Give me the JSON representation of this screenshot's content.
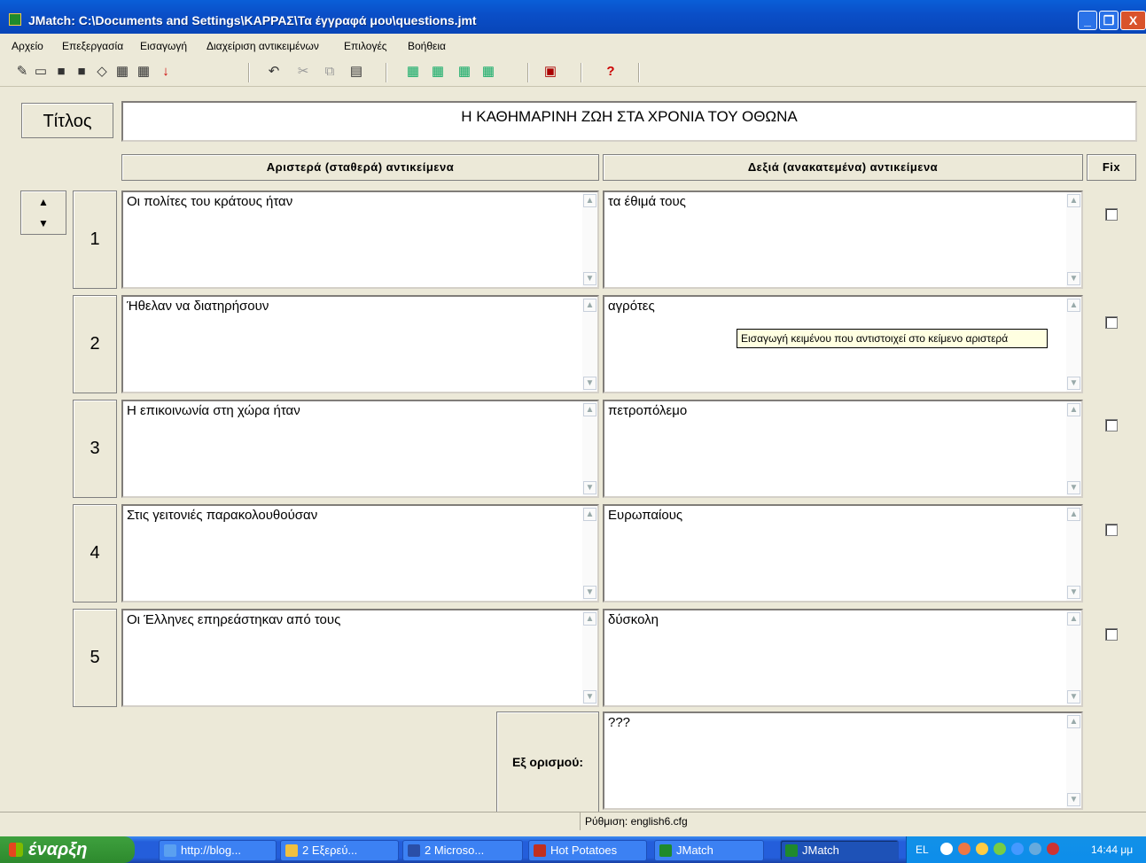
{
  "window": {
    "title": "JMatch: C:\\Documents and Settings\\ΚΑΡΡΑΣ\\Τα έγγραφά μου\\questions.jmt",
    "minimize": "_",
    "maximize": "❐",
    "close": "X"
  },
  "menu": [
    "Αρχείο",
    "Επεξεργασία",
    "Εισαγωγή",
    "Διαχείριση αντικειμένων",
    "Επιλογές",
    "Βοήθεια"
  ],
  "title_label": "Τίτλος",
  "title_value": "Η ΚΑΘΗΜΑΡΙΝΗ ΖΩΗ ΣΤΑ ΧΡΟΝΙΑ ΤΟΥ ΟΘΩΝΑ",
  "headers": {
    "left": "Αριστερά (σταθερά) αντικείμενα",
    "right": "Δεξιά (ανακατεμένα) αντικείμενα",
    "fix": "Fix"
  },
  "rows": [
    {
      "num": "1",
      "left": "Οι πολίτες του κράτους ήταν",
      "right": "τα έθιμά τους"
    },
    {
      "num": "2",
      "left": "Ήθελαν να διατηρήσουν",
      "right": "αγρότες"
    },
    {
      "num": "3",
      "left": "Η επικοινωνία στη χώρα  ήταν",
      "right": "πετροπόλεμο"
    },
    {
      "num": "4",
      "left": "Στις γειτονιές παρακολουθούσαν",
      "right": "Ευρωπαίους"
    },
    {
      "num": "5",
      "left": "Οι Έλληνες επηρεάστηκαν από τους",
      "right": "δύσκολη"
    }
  ],
  "tooltip": "Εισαγωγή κειμένου που αντιστοιχεί στο κείμενο αριστερά",
  "default": {
    "label": "Εξ ορισμού:",
    "value": "???"
  },
  "status": "Ρύθμιση: english6.cfg",
  "taskbar": {
    "start": "έναρξη",
    "tasks": [
      "http://blog...",
      "2 Εξερεύ...",
      "2 Microso...",
      "Hot Potatoes",
      "JMatch",
      "JMatch"
    ],
    "lang": "EL",
    "clock": "14:44 μμ"
  },
  "colors": {
    "accent": "#0a5fd8",
    "face": "#ece9d8",
    "start": "#3ea03e"
  }
}
